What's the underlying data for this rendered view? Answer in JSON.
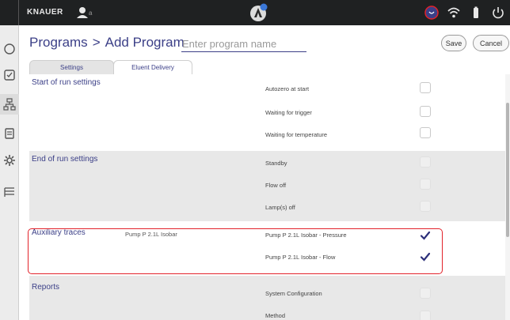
{
  "statusbar": {
    "logo": "KNAUER",
    "user_sub": "a",
    "icons": [
      "user-icon",
      "knauer-center-logo-icon",
      "power-circle-icon",
      "wifi-icon",
      "battery-icon",
      "shutdown-icon"
    ]
  },
  "nav": {
    "items": [
      "status-icon",
      "checklist-icon",
      "instrument-tree-icon",
      "report-icon",
      "gear-icon",
      "list-icon"
    ]
  },
  "header": {
    "title_part1": "Programs",
    "title_sep": ">",
    "title_part2": "Add Program",
    "name_placeholder": "Enter program name",
    "save_label": "Save",
    "cancel_label": "Cancel"
  },
  "tabs": [
    {
      "label": "Settings",
      "active": true
    },
    {
      "label": "Eluent Delivery",
      "active": false
    }
  ],
  "sections": {
    "start": {
      "title": "Start of run settings",
      "options": [
        {
          "label": "Autozero at start",
          "checked": false
        },
        {
          "label": "Waiting for trigger",
          "checked": false
        },
        {
          "label": "Waiting for temperature",
          "checked": false
        }
      ]
    },
    "end": {
      "title": "End of run settings",
      "options": [
        {
          "label": "Standby",
          "checked": false
        },
        {
          "label": "Flow off",
          "checked": false
        },
        {
          "label": "Lamp(s) off",
          "checked": false
        }
      ]
    },
    "aux": {
      "title": "Auxiliary traces",
      "device": "Pump P 2.1L Isobar",
      "options": [
        {
          "label": "Pump P 2.1L Isobar - Pressure",
          "checked": true
        },
        {
          "label": "Pump P 2.1L Isobar - Flow",
          "checked": true
        }
      ]
    },
    "reports": {
      "title": "Reports",
      "options": [
        {
          "label": "System Configuration",
          "checked": false
        },
        {
          "label": "Method",
          "checked": false
        }
      ]
    }
  },
  "colors": {
    "accent": "#3b3f87",
    "highlight": "#e2222a",
    "check": "#2c2f7a"
  }
}
